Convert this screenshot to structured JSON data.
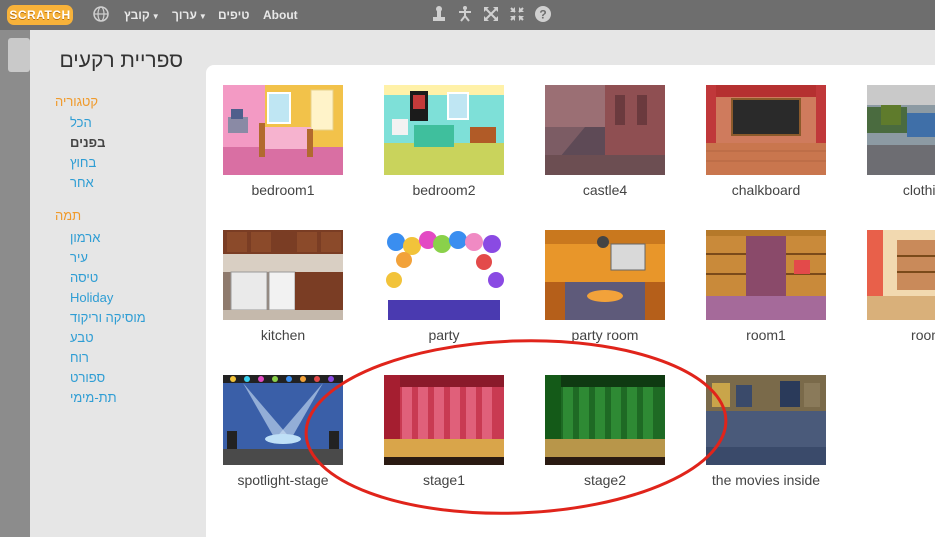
{
  "topbar": {
    "logo_text": "SCRATCH",
    "menus": [
      {
        "label": "קובץ"
      },
      {
        "label": "ערוך"
      },
      {
        "label": "טיפים"
      },
      {
        "label": "About"
      }
    ],
    "tools": [
      "duplicate-stamp-icon",
      "cut-icon",
      "grow-icon",
      "shrink-icon",
      "help-icon"
    ]
  },
  "dialog": {
    "title": "ספריית רקעים"
  },
  "sidebar": {
    "category_heading": "קטגוריה",
    "categories": [
      {
        "label": "הכל",
        "selected": false
      },
      {
        "label": "בפנים",
        "selected": true
      },
      {
        "label": "בחוץ",
        "selected": false
      },
      {
        "label": "אחר",
        "selected": false
      }
    ],
    "theme_heading": "תמה",
    "themes": [
      {
        "label": "ארמון"
      },
      {
        "label": "עיר"
      },
      {
        "label": "טיסה"
      },
      {
        "label": "Holiday"
      },
      {
        "label": "מוסיקה וריקוד"
      },
      {
        "label": "טבע"
      },
      {
        "label": "רוח"
      },
      {
        "label": "ספורט"
      },
      {
        "label": "תת-מימי"
      }
    ]
  },
  "backdrops": [
    {
      "name": "bedroom1"
    },
    {
      "name": "bedroom2"
    },
    {
      "name": "castle4"
    },
    {
      "name": "chalkboard"
    },
    {
      "name": "clothing"
    },
    {
      "name": "kitchen"
    },
    {
      "name": "party"
    },
    {
      "name": "party room"
    },
    {
      "name": "room1"
    },
    {
      "name": "room"
    },
    {
      "name": "spotlight-stage"
    },
    {
      "name": "stage1"
    },
    {
      "name": "stage2"
    },
    {
      "name": "the movies inside"
    }
  ],
  "colors": {
    "topbar": "#6e6e6e",
    "accent_orange": "#f09a2b",
    "link_blue": "#2e9dd4",
    "annotation_red": "#e0241b"
  }
}
